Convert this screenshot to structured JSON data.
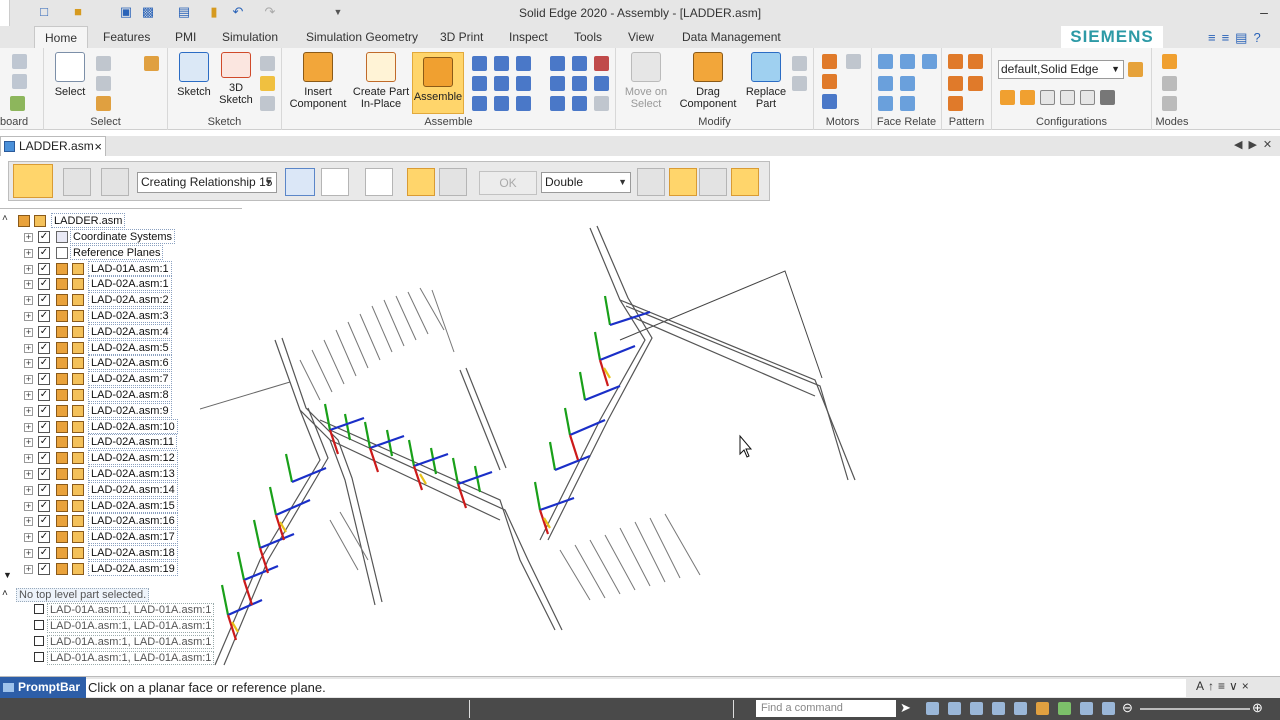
{
  "window": {
    "title": "Solid Edge 2020 - Assembly - [LADDER.asm]"
  },
  "ribbon_tabs": [
    "Home",
    "Features",
    "PMI",
    "Simulation",
    "Simulation Geometry",
    "3D Print",
    "Inspect",
    "Tools",
    "View",
    "Data Management"
  ],
  "brand": "SIEMENS",
  "ribbon": {
    "select_label": "Select",
    "clipboard_label": "board",
    "group_select": "Select",
    "sketch_label": "Sketch",
    "sketch3d_label_1": "3D",
    "sketch3d_label_2": "Sketch",
    "group_sketch": "Sketch",
    "insert_component_1": "Insert",
    "insert_component_2": "Component",
    "create_part_1": "Create Part",
    "create_part_2": "In-Place",
    "assemble": "Assemble",
    "group_assemble": "Assemble",
    "move_on_select_1": "Move on",
    "move_on_select_2": "Select",
    "drag_component_1": "Drag",
    "drag_component_2": "Component",
    "replace_part_1": "Replace",
    "replace_part_2": "Part",
    "group_modify": "Modify",
    "group_motors": "Motors",
    "group_face_relate": "Face Relate",
    "group_pattern": "Pattern",
    "configuration_value": "default,Solid Edge",
    "group_configurations": "Configurations",
    "group_modes": "Modes"
  },
  "document_tab": "LADDER.asm",
  "command_bar": {
    "relationship": "Creating Relationship 15",
    "ok": "OK",
    "offset_type": "Double"
  },
  "tree": {
    "root": "LADDER.asm",
    "items": [
      "Coordinate Systems",
      "Reference Planes",
      "LAD-01A.asm:1",
      "LAD-02A.asm:1",
      "LAD-02A.asm:2",
      "LAD-02A.asm:3",
      "LAD-02A.asm:4",
      "LAD-02A.asm:5",
      "LAD-02A.asm:6",
      "LAD-02A.asm:7",
      "LAD-02A.asm:8",
      "LAD-02A.asm:9",
      "LAD-02A.asm:10",
      "LAD-02A.asm:11",
      "LAD-02A.asm:12",
      "LAD-02A.asm:13",
      "LAD-02A.asm:14",
      "LAD-02A.asm:15",
      "LAD-02A.asm:16",
      "LAD-02A.asm:17",
      "LAD-02A.asm:18",
      "LAD-02A.asm:19"
    ]
  },
  "lower_pane": {
    "status": "No top level part selected.",
    "relationships": [
      "LAD-01A.asm:1, LAD-01A.asm:1",
      "LAD-01A.asm:1, LAD-01A.asm:1",
      "LAD-01A.asm:1, LAD-01A.asm:1",
      "LAD-01A.asm:1, LAD-01A.asm:1"
    ]
  },
  "prompt": {
    "label": "PromptBar",
    "text": "Click on a planar face or reference plane."
  },
  "statusbar": {
    "find_placeholder": "Find a command"
  }
}
